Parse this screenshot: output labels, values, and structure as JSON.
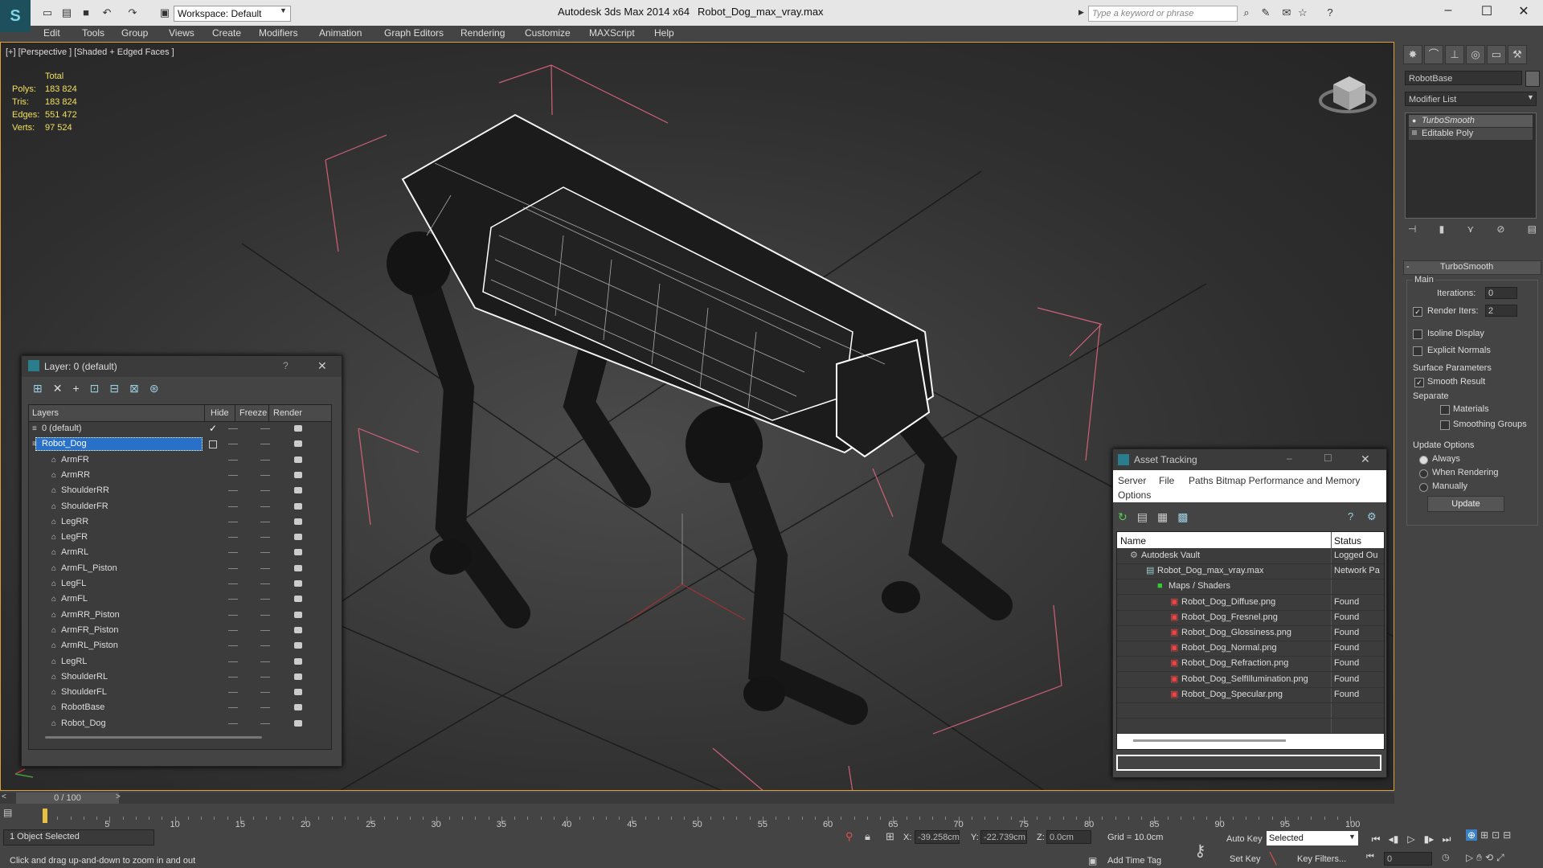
{
  "app": {
    "title": "Autodesk 3ds Max  2014 x64",
    "file": "Robot_Dog_max_vray.max",
    "workspace": "Workspace: Default",
    "search_placeholder": "Type a keyword or phrase"
  },
  "menu": [
    "Edit",
    "Tools",
    "Group",
    "Views",
    "Create",
    "Modifiers",
    "Animation",
    "Graph Editors",
    "Rendering",
    "Customize",
    "MAXScript",
    "Help"
  ],
  "viewport": {
    "label": "[+] [Perspective ] [Shaded + Edged Faces ]",
    "stats": {
      "header": "Total",
      "rows": [
        {
          "label": "Polys:",
          "value": "183 824"
        },
        {
          "label": "Tris:",
          "value": "183 824"
        },
        {
          "label": "Edges:",
          "value": "551 472"
        },
        {
          "label": "Verts:",
          "value": "97 524"
        }
      ]
    }
  },
  "command_panel": {
    "object_name": "RobotBase",
    "modifier_list": "Modifier List",
    "stack": [
      "TurboSmooth",
      "Editable Poly"
    ],
    "rollout_title": "TurboSmooth",
    "main_label": "Main",
    "iterations_label": "Iterations:",
    "iterations_value": "0",
    "render_iters_label": "Render Iters:",
    "render_iters_value": "2",
    "isoline": "Isoline Display",
    "explicit_normals": "Explicit Normals",
    "surface_params": "Surface Parameters",
    "smooth_result": "Smooth Result",
    "separate": "Separate",
    "materials": "Materials",
    "smoothing_groups": "Smoothing Groups",
    "update_options": "Update Options",
    "always": "Always",
    "when_rendering": "When Rendering",
    "manually": "Manually",
    "update_button": "Update"
  },
  "layer_window": {
    "title": "Layer: 0 (default)",
    "col_layers": "Layers",
    "col_hide": "Hide",
    "col_freeze": "Freeze",
    "col_render": "Render",
    "layers": [
      "0 (default)",
      "Robot_Dog"
    ],
    "objects": [
      "ArmFR",
      "ArmRR",
      "ShoulderRR",
      "ShoulderFR",
      "LegRR",
      "LegFR",
      "ArmRL",
      "ArmFL_Piston",
      "LegFL",
      "ArmFL",
      "ArmRR_Piston",
      "ArmFR_Piston",
      "ArmRL_Piston",
      "LegRL",
      "ShoulderRL",
      "ShoulderFL",
      "RobotBase",
      "Robot_Dog"
    ]
  },
  "asset_tracking": {
    "title": "Asset Tracking",
    "menu": [
      "Server",
      "File",
      "Paths",
      "Bitmap Performance and Memory",
      "Options"
    ],
    "col_name": "Name",
    "col_status": "Status",
    "rows": [
      {
        "name": "Autodesk Vault",
        "status": "Logged Ou"
      },
      {
        "name": "Robot_Dog_max_vray.max",
        "status": "Network Pa"
      },
      {
        "name": "Maps / Shaders",
        "status": ""
      },
      {
        "name": "Robot_Dog_Diffuse.png",
        "status": "Found"
      },
      {
        "name": "Robot_Dog_Fresnel.png",
        "status": "Found"
      },
      {
        "name": "Robot_Dog_Glossiness.png",
        "status": "Found"
      },
      {
        "name": "Robot_Dog_Normal.png",
        "status": "Found"
      },
      {
        "name": "Robot_Dog_Refraction.png",
        "status": "Found"
      },
      {
        "name": "Robot_Dog_SelfIllumination.png",
        "status": "Found"
      },
      {
        "name": "Robot_Dog_Specular.png",
        "status": "Found"
      }
    ]
  },
  "timeline": {
    "frame": "0 / 100",
    "ticks": [
      "5",
      "10",
      "15",
      "20",
      "25",
      "30",
      "35",
      "40",
      "45",
      "50",
      "55",
      "60",
      "65",
      "70",
      "75",
      "80",
      "85",
      "90",
      "95",
      "100"
    ]
  },
  "status": {
    "selected": "1 Object Selected",
    "hint": "Click and drag up-and-down to zoom in and out",
    "x_label": "X:",
    "x_value": "-39.258cm",
    "y_label": "Y:",
    "y_value": "-22.739cm",
    "z_label": "Z:",
    "z_value": "0.0cm",
    "grid": "Grid = 10.0cm",
    "add_time_tag": "Add Time Tag",
    "auto_key": "Auto Key",
    "selected_dropdown": "Selected",
    "set_key": "Set Key",
    "key_filters": "Key Filters...",
    "frame_value": "0"
  }
}
